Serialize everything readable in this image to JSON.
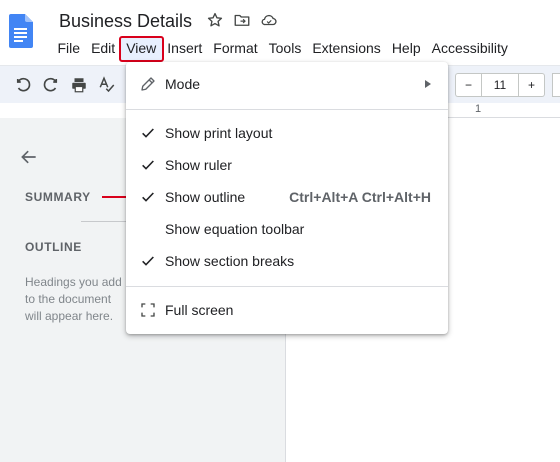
{
  "app": {
    "doc_title": "Business Details",
    "icons": [
      "docs-logo-icon",
      "star-icon",
      "move-folder-icon",
      "cloud-status-icon"
    ],
    "accent": "#4285f4",
    "highlight": "#d9001b"
  },
  "menu": {
    "items": [
      "File",
      "Edit",
      "View",
      "Insert",
      "Format",
      "Tools",
      "Extensions",
      "Help",
      "Accessibility"
    ],
    "active": "View"
  },
  "toolbar": {
    "icons": [
      "undo-icon",
      "redo-icon",
      "print-icon",
      "spellcheck-icon"
    ],
    "font_size": "11",
    "decrease_label": "−",
    "increase_label": "+",
    "ruler_mark": "1"
  },
  "side_panel": {
    "summary_label": "SUMMARY",
    "outline_label": "OUTLINE",
    "hint_text": "Headings you add to the document will appear here."
  },
  "view_menu": {
    "mode": {
      "label": "Mode",
      "icon": "pencil-icon"
    },
    "print_layout": {
      "label": "Show print layout",
      "checked": true
    },
    "ruler": {
      "label": "Show ruler",
      "checked": true
    },
    "outline": {
      "label": "Show outline",
      "checked": true,
      "shortcut": "Ctrl+Alt+A Ctrl+Alt+H"
    },
    "equation_toolbar": {
      "label": "Show equation toolbar",
      "checked": false
    },
    "section_breaks": {
      "label": "Show section breaks",
      "checked": true
    },
    "full_screen": {
      "label": "Full screen",
      "icon": "fullscreen-icon"
    }
  },
  "annotation": {
    "arrow_color": "#d9001b"
  }
}
